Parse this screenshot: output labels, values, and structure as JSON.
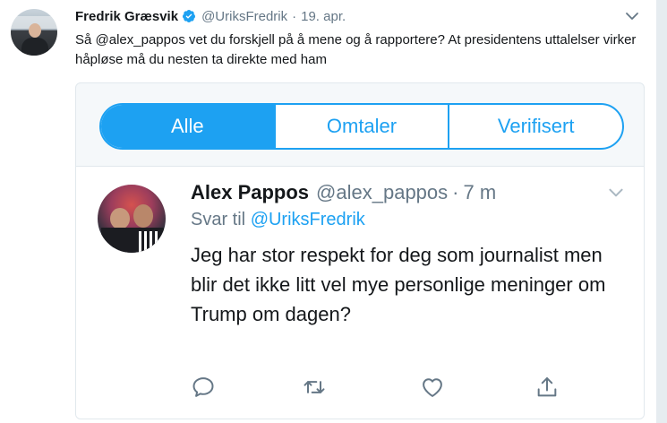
{
  "tweet": {
    "author_name": "Fredrik Græsvik",
    "handle": "@UriksFredrik",
    "separator": "·",
    "time": "19. apr.",
    "text": "Så @alex_pappos vet du forskjell på å mene og å rapportere? At presidentens uttalelser virker håpløse må du nesten ta direkte med ham",
    "verified": true
  },
  "tabs": [
    {
      "label": "Alle",
      "active": true
    },
    {
      "label": "Omtaler",
      "active": false
    },
    {
      "label": "Verifisert",
      "active": false
    }
  ],
  "embedded_tweet": {
    "author_name": "Alex Pappos",
    "handle": "@alex_pappos",
    "separator": "·",
    "time": "7 m",
    "reply_prefix": "Svar til",
    "reply_mention": "@UriksFredrik",
    "text": "Jeg har stor respekt for deg som journalist men blir det ikke litt vel mye personlige meninger om Trump om dagen?"
  },
  "icons": {
    "verified": "verified-badge-icon",
    "caret": "chevron-down-icon",
    "reply": "reply-icon",
    "retweet": "retweet-icon",
    "like": "heart-icon",
    "share": "share-icon"
  },
  "colors": {
    "accent": "#1da1f2",
    "text": "#14171a",
    "secondary": "#657786",
    "border": "#e1e8ed"
  }
}
